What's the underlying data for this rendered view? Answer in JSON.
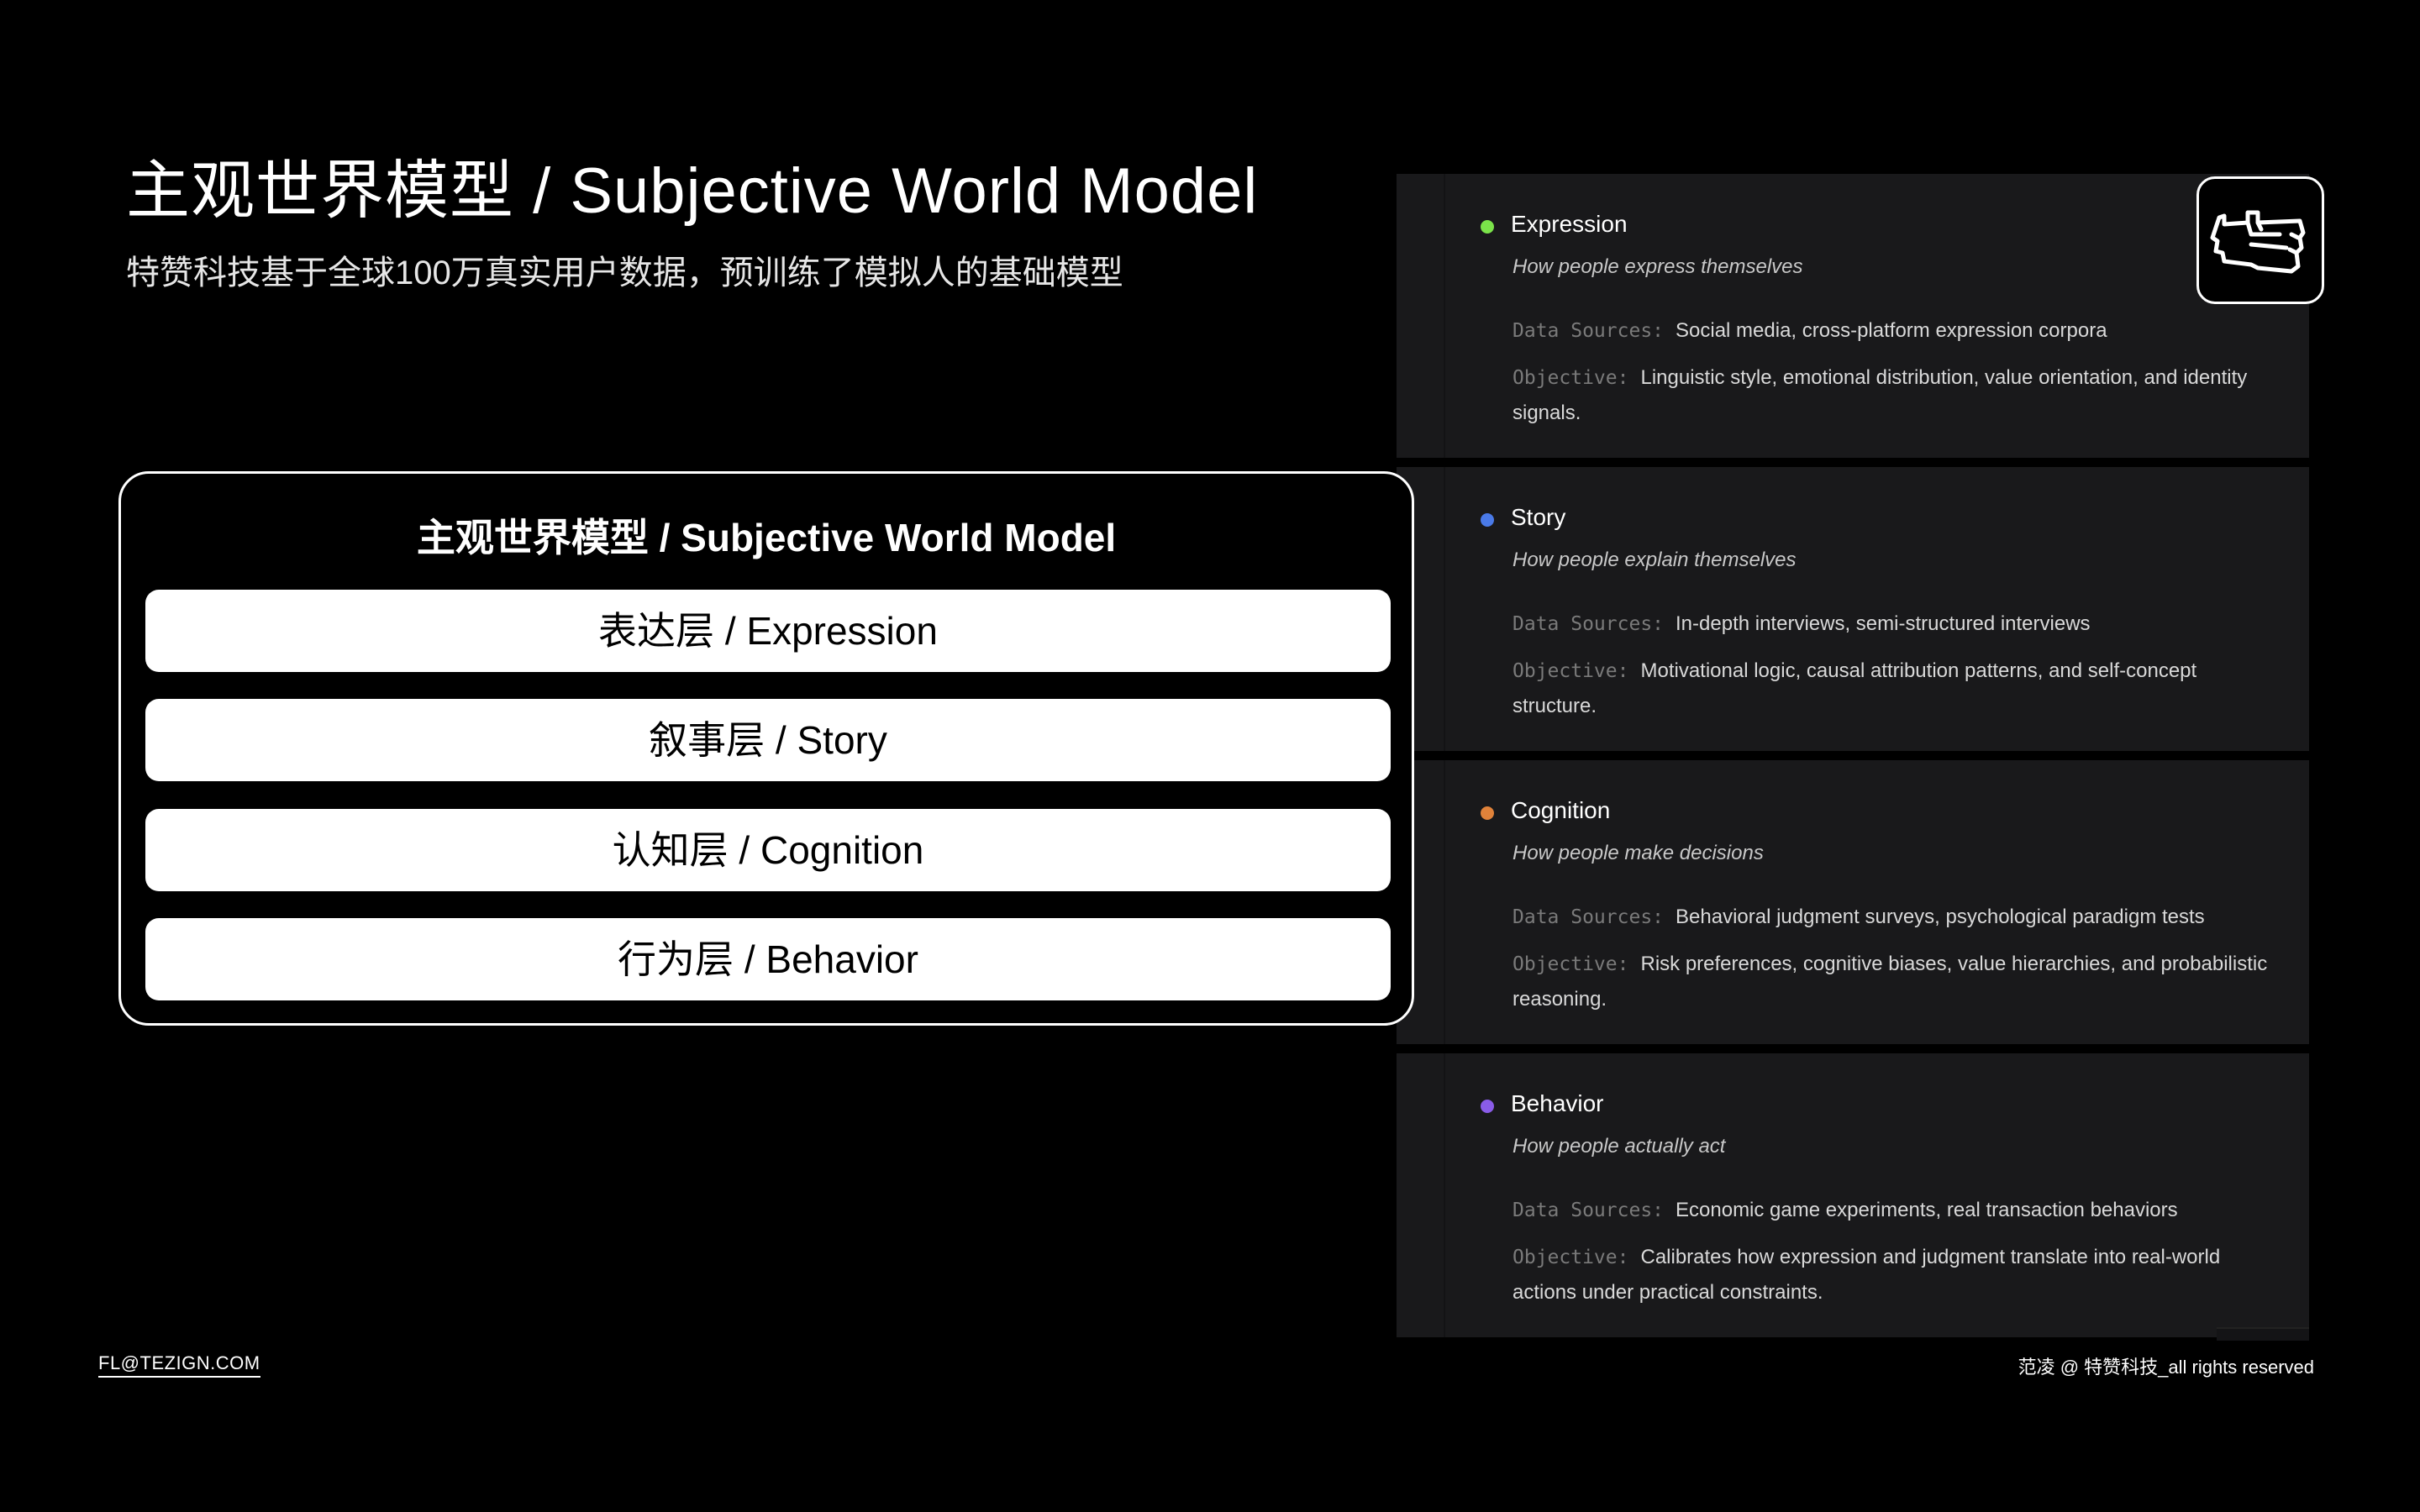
{
  "header": {
    "title": "主观世界模型 / Subjective World Model",
    "subtitle": "特赞科技基于全球100万真实用户数据，预训练了模拟人的基础模型"
  },
  "model": {
    "title": "主观世界模型 / Subjective World Model",
    "layers": [
      {
        "label": "表达层 / Expression"
      },
      {
        "label": "叙事层 / Story"
      },
      {
        "label": "认知层 / Cognition"
      },
      {
        "label": "行为层 / Behavior"
      }
    ]
  },
  "cards": [
    {
      "name": "Expression",
      "desc": "How people express themselves",
      "dot_color": "#7be34a",
      "sources_label": "Data Sources:",
      "sources": "Social media, cross-platform expression corpora",
      "objective_label": "Objective:",
      "objective": "Linguistic style, emotional distribution, value orientation, and identity signals."
    },
    {
      "name": "Story",
      "desc": "How people explain themselves",
      "dot_color": "#4a7ae8",
      "sources_label": "Data Sources:",
      "sources": "In-depth interviews, semi-structured interviews",
      "objective_label": "Objective:",
      "objective": "Motivational logic, causal attribution patterns, and self-concept structure."
    },
    {
      "name": "Cognition",
      "desc": "How people make decisions",
      "dot_color": "#e0823a",
      "sources_label": "Data Sources:",
      "sources": "Behavioral judgment surveys, psychological paradigm tests",
      "objective_label": "Objective:",
      "objective": "Risk preferences, cognitive biases, value hierarchies, and probabilistic reasoning."
    },
    {
      "name": "Behavior",
      "desc": "How people actually act",
      "dot_color": "#8a5ce8",
      "sources_label": "Data Sources:",
      "sources": "Economic game experiments, real transaction behaviors",
      "objective_label": "Objective:",
      "objective": "Calibrates how expression and judgment translate into real-world actions under practical constraints."
    }
  ],
  "logo": {
    "icon": "handshake-logo-icon"
  },
  "footer": {
    "email": "FL@TEZIGN.COM",
    "copyright": "范凌 @ 特赞科技_all rights reserved"
  }
}
